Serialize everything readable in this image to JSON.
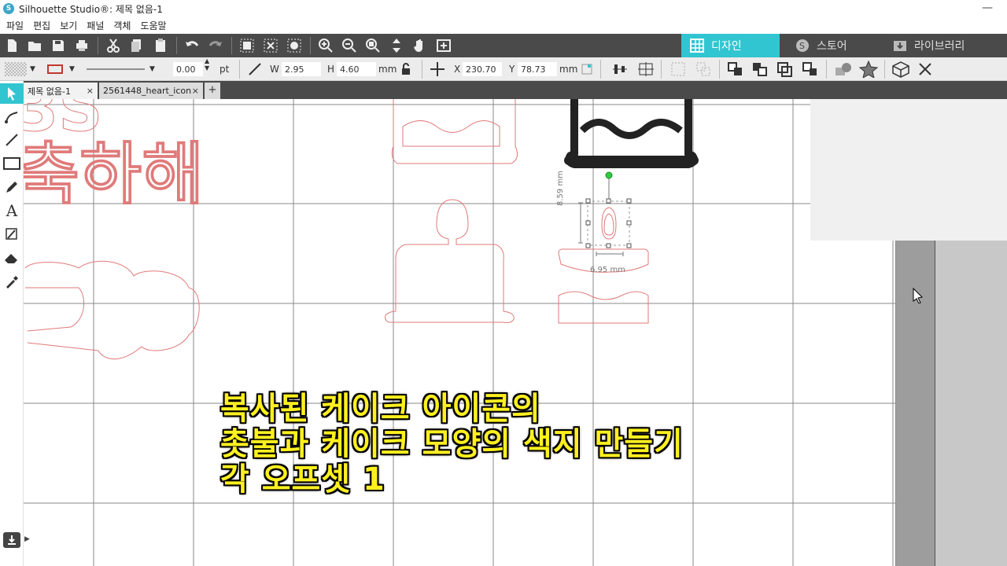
{
  "window": {
    "title": "Silhouette Studio®: 제목 없음-1",
    "minimize": "—"
  },
  "menu": [
    "파일",
    "편집",
    "보기",
    "패널",
    "객체",
    "도움말"
  ],
  "main_tabs": {
    "design": "디자인",
    "store": "스토어",
    "library": "라이브러리"
  },
  "line_width": {
    "value": "0.00",
    "unit": "pt"
  },
  "size": {
    "w_label": "W",
    "w_value": "2.95",
    "h_label": "H",
    "h_value": "4.60",
    "unit": "mm"
  },
  "position": {
    "x_label": "X",
    "x_value": "230.70",
    "y_label": "Y",
    "y_value": "78.73",
    "unit": "mm"
  },
  "doc_tabs": [
    {
      "label": "제목 없음-1",
      "close": "×"
    },
    {
      "label": "2561448_heart_icon",
      "close": "×"
    }
  ],
  "add_tab": "+",
  "dimensions": {
    "height": "8.59 mm",
    "width": "6.95 mm"
  },
  "caption": {
    "line1": "복사된 케이크 아이콘의",
    "line2": "촛불과 케이크 모양의 색지 만들기",
    "line3": "각 오프셋 1"
  },
  "colors": {
    "accent": "#31c5d1",
    "toolbar": "#4a4a4a",
    "cut_line": "#e07a7a",
    "caption": "#fff020"
  }
}
